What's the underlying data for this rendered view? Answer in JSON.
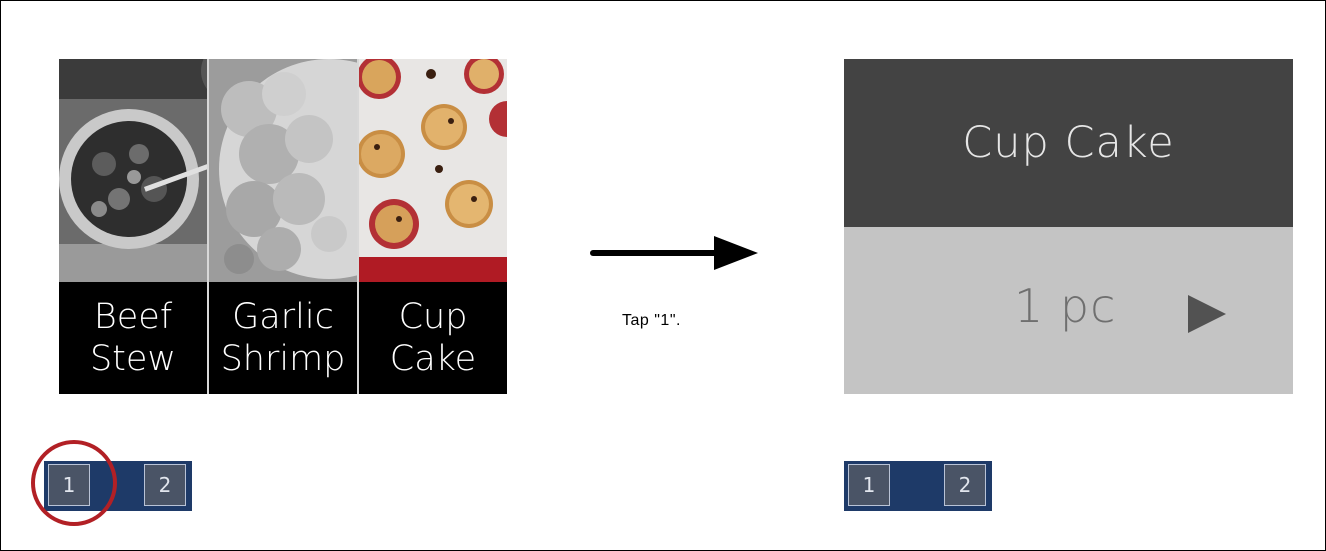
{
  "recipes": [
    {
      "line1": "Beef",
      "line2": "Stew",
      "icon": "beef-stew-photo"
    },
    {
      "line1": "Garlic",
      "line2": "Shrimp",
      "icon": "garlic-shrimp-photo"
    },
    {
      "line1": "Cup",
      "line2": "Cake",
      "icon": "cup-cake-photo"
    }
  ],
  "instruction": "Tap \"1\".",
  "detail": {
    "title": "Cup Cake",
    "quantity": "1 pc",
    "next_icon": "play-icon"
  },
  "pager_left": {
    "page1": "1",
    "page2": "2"
  },
  "pager_right": {
    "page1": "1",
    "page2": "2"
  },
  "colors": {
    "highlight_circle": "#b22025",
    "pager_bg": "#1e3a68",
    "title_bar": "#434343",
    "qty_bar": "#c4c4c4"
  }
}
